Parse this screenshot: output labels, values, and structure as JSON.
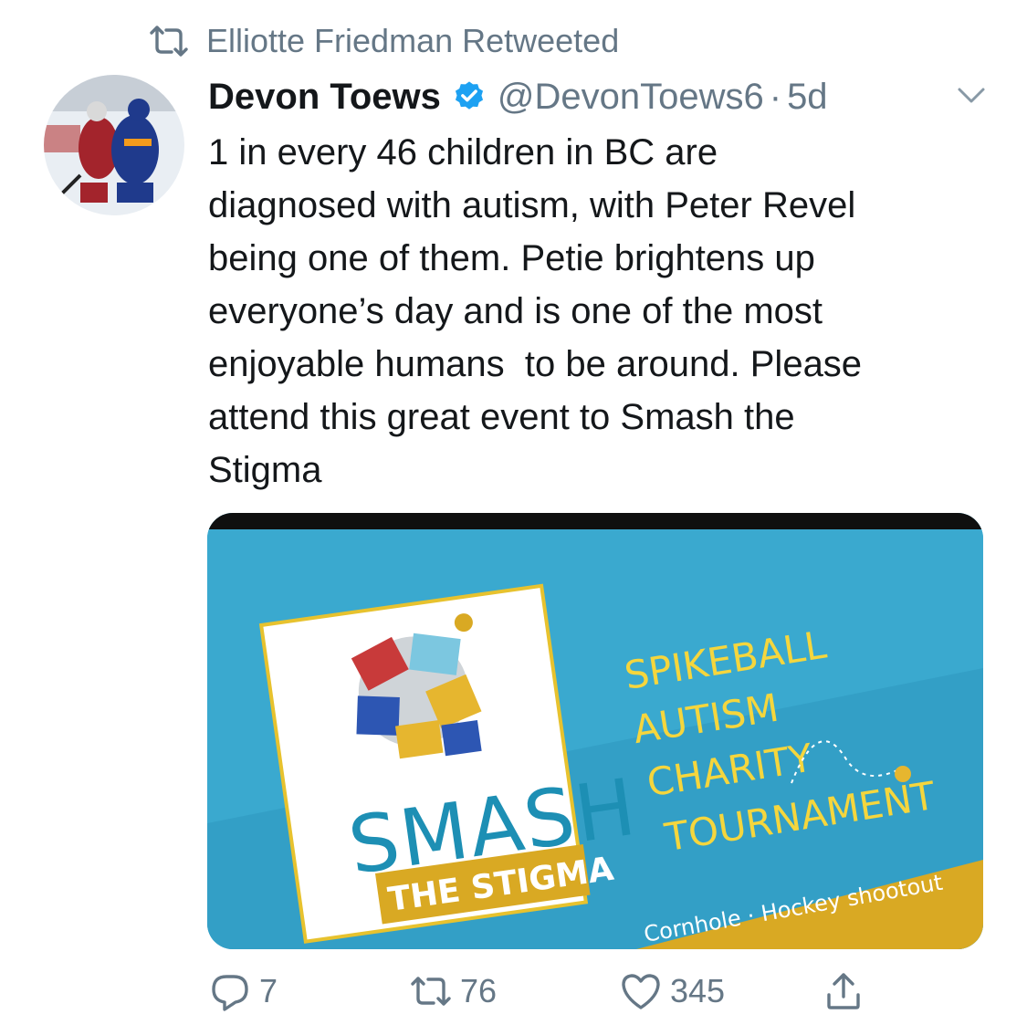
{
  "retweet_context": {
    "label": "Elliotte Friedman Retweeted",
    "icon": "retweet-icon"
  },
  "author": {
    "name": "Devon Toews",
    "verified_icon": "verified-badge-icon",
    "handle": "@DevonToews6",
    "separator": "·",
    "time": "5d"
  },
  "menu": {
    "icon": "chevron-down-icon"
  },
  "tweet": {
    "lines": [
      "1 in every 46 children in BC are",
      "diagnosed with autism, with Peter Revel",
      "being one of them. Petie brightens up",
      "everyone’s day and is one of the most",
      "enjoyable humans  to be around. Please",
      "attend this great event to Smash the",
      "Stigma"
    ]
  },
  "media": {
    "poster": {
      "logo_word": "SMASH",
      "logo_banner": "THE STIGMA",
      "headline": [
        "SPIKEBALL",
        "AUTISM",
        "CHARITY",
        "TOURNAMENT"
      ],
      "footer": "Cornhole · Hockey shootout"
    }
  },
  "actions": {
    "reply": {
      "icon": "reply-icon",
      "count": "7"
    },
    "retweet": {
      "icon": "retweet-icon",
      "count": "76"
    },
    "like": {
      "icon": "heart-icon",
      "count": "345"
    },
    "share": {
      "icon": "share-icon"
    }
  },
  "colors": {
    "text": "#14171a",
    "secondary": "#657786",
    "verified": "#1da1f2",
    "poster_bg": "#3aa9cf",
    "poster_yellow": "#f5d63d",
    "poster_gold": "#d9a923"
  }
}
